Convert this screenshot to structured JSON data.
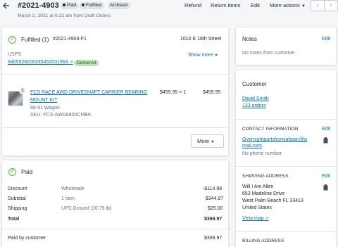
{
  "header": {
    "order_number": "#2021-4903",
    "badges": [
      "Paid",
      "Fulfilled",
      "Archived"
    ],
    "actions": [
      "Refund",
      "Return items",
      "Edit",
      "More actions"
    ],
    "subline": "March 2, 2021 at 6:32 am from Draft Orders"
  },
  "fulfilled": {
    "title": "Fulfilled (1)",
    "fulfillment_id": "#2021-4903-F1",
    "location": "1010 E 18th Street",
    "carrier": "USPS",
    "tracking_number": "9405528206335452031964",
    "delivery_status": "Delivered",
    "show_more": "Show more",
    "item": {
      "quantity_badge": "1",
      "name_line1": "FCS RACE AWD DRIVESHAFT CARRIER BEARING",
      "name_line2": "MOUNT KIT",
      "variant": "88-91 Wagon",
      "sku": "SKU: FCS-AWD8800CMBK",
      "unit_price": "$459.95 × 1",
      "total": "$459.95"
    },
    "more_button": "More"
  },
  "payment": {
    "title": "Paid",
    "rows": [
      {
        "label": "Discount",
        "detail": "Wholesale",
        "amount": "-$114.98"
      },
      {
        "label": "Subtotal",
        "detail": "1 item",
        "amount": "$344.97"
      },
      {
        "label": "Shipping",
        "detail": "UPS Ground (20.75 lb)",
        "amount": "$25.00"
      },
      {
        "label": "Total",
        "detail": "",
        "amount": "$369.97"
      }
    ],
    "paid_by_label": "Paid by customer",
    "paid_by_amount": "$369.97"
  },
  "notes": {
    "title": "Notes",
    "edit": "Edit",
    "body": "No notes from customer"
  },
  "customer": {
    "title": "Customer",
    "name": "David Smith",
    "orders": "133 orders",
    "contact_title": "CONTACT INFORMATION",
    "contact_edit": "Edit",
    "email_line1": "Overnightpartsfromjahpan@g",
    "email_line2": "mail.com",
    "phone": "No phone number",
    "shipping_title": "SHIPPING ADDRESS",
    "shipping_edit": "Edit",
    "address": [
      "Will I Am Allen",
      "653 Madeline Drive",
      "West Palm Beach FL 33413",
      "United States"
    ],
    "view_map": "View map",
    "billing_title": "BILLING ADDRESS"
  },
  "colors": {
    "accent": "#006fbb",
    "success": "#50b83c",
    "delivered_bg": "#bbe5b3"
  },
  "icons": [
    "arrow-left-icon",
    "external-link-icon",
    "caret-down-icon",
    "copy-icon",
    "chevron-left-icon",
    "chevron-right-icon",
    "check-circle-icon"
  ]
}
